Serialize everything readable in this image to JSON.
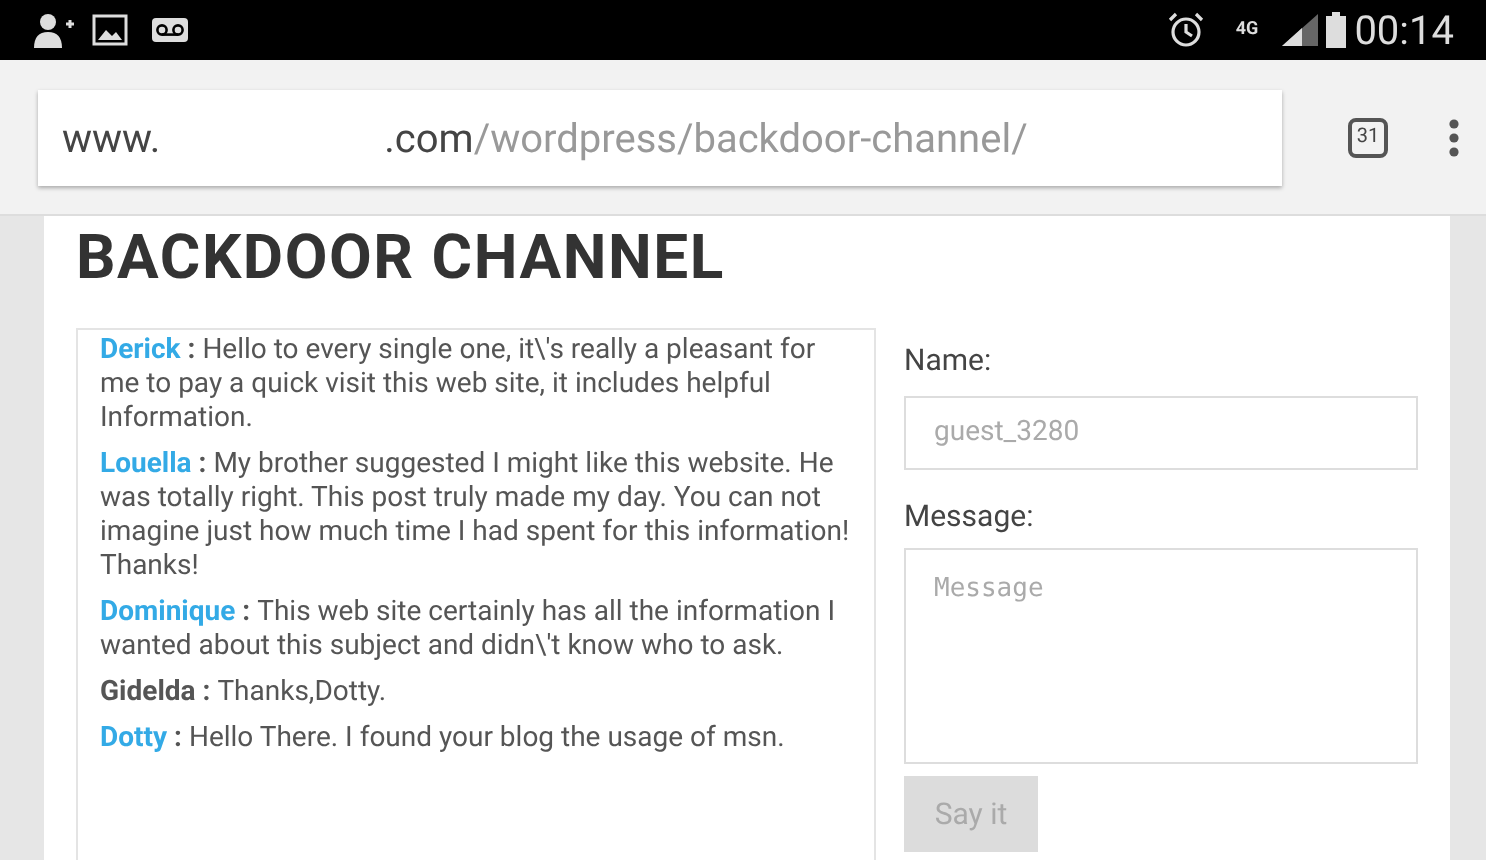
{
  "status_bar": {
    "time": "00:14",
    "network": "4G"
  },
  "address_bar": {
    "host": "www.",
    "domain": ".com",
    "path": "/wordpress/backdoor-channel/",
    "tab_count": "31"
  },
  "page": {
    "title": "BACKDOOR CHANNEL",
    "comments": [
      {
        "author": "Derick",
        "color": "#33aae6",
        "separator": ":",
        "text": "Hello to every single one, it\\'s really a pleasant for me to pay a quick visit this web site, it includes helpful Information."
      },
      {
        "author": "Louella",
        "color": "#33aae6",
        "separator": ":",
        "text": "My brother suggested I might like this website. He was totally right. This post truly made my day. You can not imagine just how much time I had spent for this information! Thanks!"
      },
      {
        "author": "Dominique",
        "color": "#33aae6",
        "separator": ":",
        "text": "This web site certainly has all the information I wanted about this subject and didn\\'t know who to ask."
      },
      {
        "author": "Gidelda",
        "color": "#555555",
        "separator": ":",
        "text": "Thanks,Dotty."
      },
      {
        "author": "Dotty",
        "color": "#33aae6",
        "separator": ":",
        "text": "Hello There. I found your blog the usage of msn."
      }
    ],
    "form": {
      "name_label": "Name:",
      "name_placeholder": "guest_3280",
      "message_label": "Message:",
      "message_placeholder": "Message",
      "submit": "Say it",
      "submit_disabled": true
    }
  }
}
